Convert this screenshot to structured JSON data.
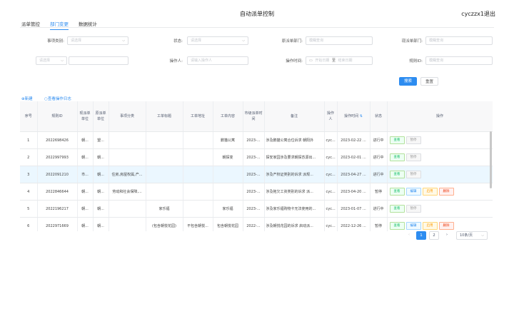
{
  "header": {
    "title": "自动派单控制",
    "user": "cyczzx1退出"
  },
  "tabs": [
    "派单管控",
    "部门变更",
    "数据统计"
  ],
  "filters": {
    "event_category": {
      "label": "事项类别:",
      "placeholder": "请选择"
    },
    "status": {
      "label": "状态:",
      "placeholder": "请选择"
    },
    "dispatch_dept": {
      "label": "原派单部门:",
      "placeholder": "模糊查询"
    },
    "current_dept": {
      "label": "现派单部门:",
      "placeholder": "模糊查询"
    },
    "extra_select": {
      "placeholder": "请选择"
    },
    "operator": {
      "label": "操作人:",
      "placeholder": "请输入操作人"
    },
    "op_time": {
      "label": "操作时间:",
      "start": "开始日期",
      "sep": "至",
      "end": "结束日期"
    },
    "rule_id": {
      "label": "规则ID:",
      "placeholder": "模糊查询"
    },
    "search_label": "搜索",
    "reset_label": "重置"
  },
  "actions": {
    "new_label": "新建",
    "log_label": "查看操作日志"
  },
  "table": {
    "headers": [
      "序号",
      "规则ID",
      "现派单单位",
      "原派单单位",
      "事项分类",
      "工单标题",
      "工单地址",
      "工单内容",
      "市级派单时间",
      "备注",
      "操作人",
      "操作时间",
      "状态",
      "操作"
    ],
    "rows": [
      {
        "no": "1",
        "id": "2022698426",
        "cur": "朝...",
        "orig": "望...",
        "cat": "",
        "title": "",
        "addr": "",
        "content": "鹏猫公寓",
        "time": "2023-...",
        "note": "涉及鹏猫公寓合位诉求 朝阳外",
        "op": "cyc...",
        "optime": "2023-02-22 ...",
        "status": "进行中",
        "btns": [
          "查看",
          "暂停"
        ]
      },
      {
        "no": "2",
        "id": "2022997993",
        "cur": "朝...",
        "orig": "朝...",
        "cat": "",
        "title": "",
        "addr": "",
        "content": "朝探变",
        "time": "2023-...",
        "note": "探安家园涉及要求朝探苏源出...",
        "op": "cyc...",
        "optime": "2023-02-01 ...",
        "status": "进行中",
        "btns": [
          "查看",
          "暂停"
        ]
      },
      {
        "no": "3",
        "id": "2022091210",
        "cur": "市...",
        "orig": "朝...",
        "cat": "住房,房屋权属,产...",
        "title": "",
        "addr": "",
        "content": "",
        "time": "2023-...",
        "note": "涉及产权证类别的诉求 派规...",
        "op": "cyc...",
        "optime": "2023-04-27 ...",
        "status": "进行中",
        "btns": [
          "查看",
          "暂停"
        ]
      },
      {
        "no": "4",
        "id": "2022846644",
        "cur": "朝...",
        "orig": "朝...",
        "cat": "劳动和社会保障,...",
        "title": "",
        "addr": "",
        "content": "",
        "time": "2023-...",
        "note": "涉及拖欠工资类别的诉求 派...",
        "op": "cyc...",
        "optime": "2023-04-20 ...",
        "status": "暂停",
        "btns": [
          "查看",
          "编辑",
          "启用",
          "删除"
        ]
      },
      {
        "no": "5",
        "id": "2022196217",
        "cur": "朝...",
        "orig": "朝...",
        "cat": "",
        "title": "家乐福",
        "addr": "",
        "content": "家乐福",
        "time": "2023-...",
        "note": "涉及家乐福购物卡无法使用的...",
        "op": "cyc...",
        "optime": "2023-01-07 ...",
        "status": "进行中",
        "btns": [
          "查看",
          "暂停"
        ]
      },
      {
        "no": "6",
        "id": "2022971669",
        "cur": "朝...",
        "orig": "朝...",
        "cat": "",
        "title": "(包含朝悦花园)",
        "addr": "不包含朝悦...",
        "content": "包含朝悦花园",
        "time": "2022-...",
        "note": "涉及朝悦花园的诉求 启动派...",
        "op": "cyc...",
        "optime": "2022-12-26 ...",
        "status": "暂停",
        "btns": [
          "查看",
          "编辑",
          "启用",
          "删除"
        ]
      }
    ]
  },
  "pagination": {
    "prev": "‹",
    "pages": [
      "1",
      "2"
    ],
    "next": "›",
    "page_size": "10条/页"
  },
  "colors": {
    "accent": "#2d8cf0",
    "green": "#19be6b",
    "orange": "#ff9900",
    "red": "#ed4014"
  }
}
